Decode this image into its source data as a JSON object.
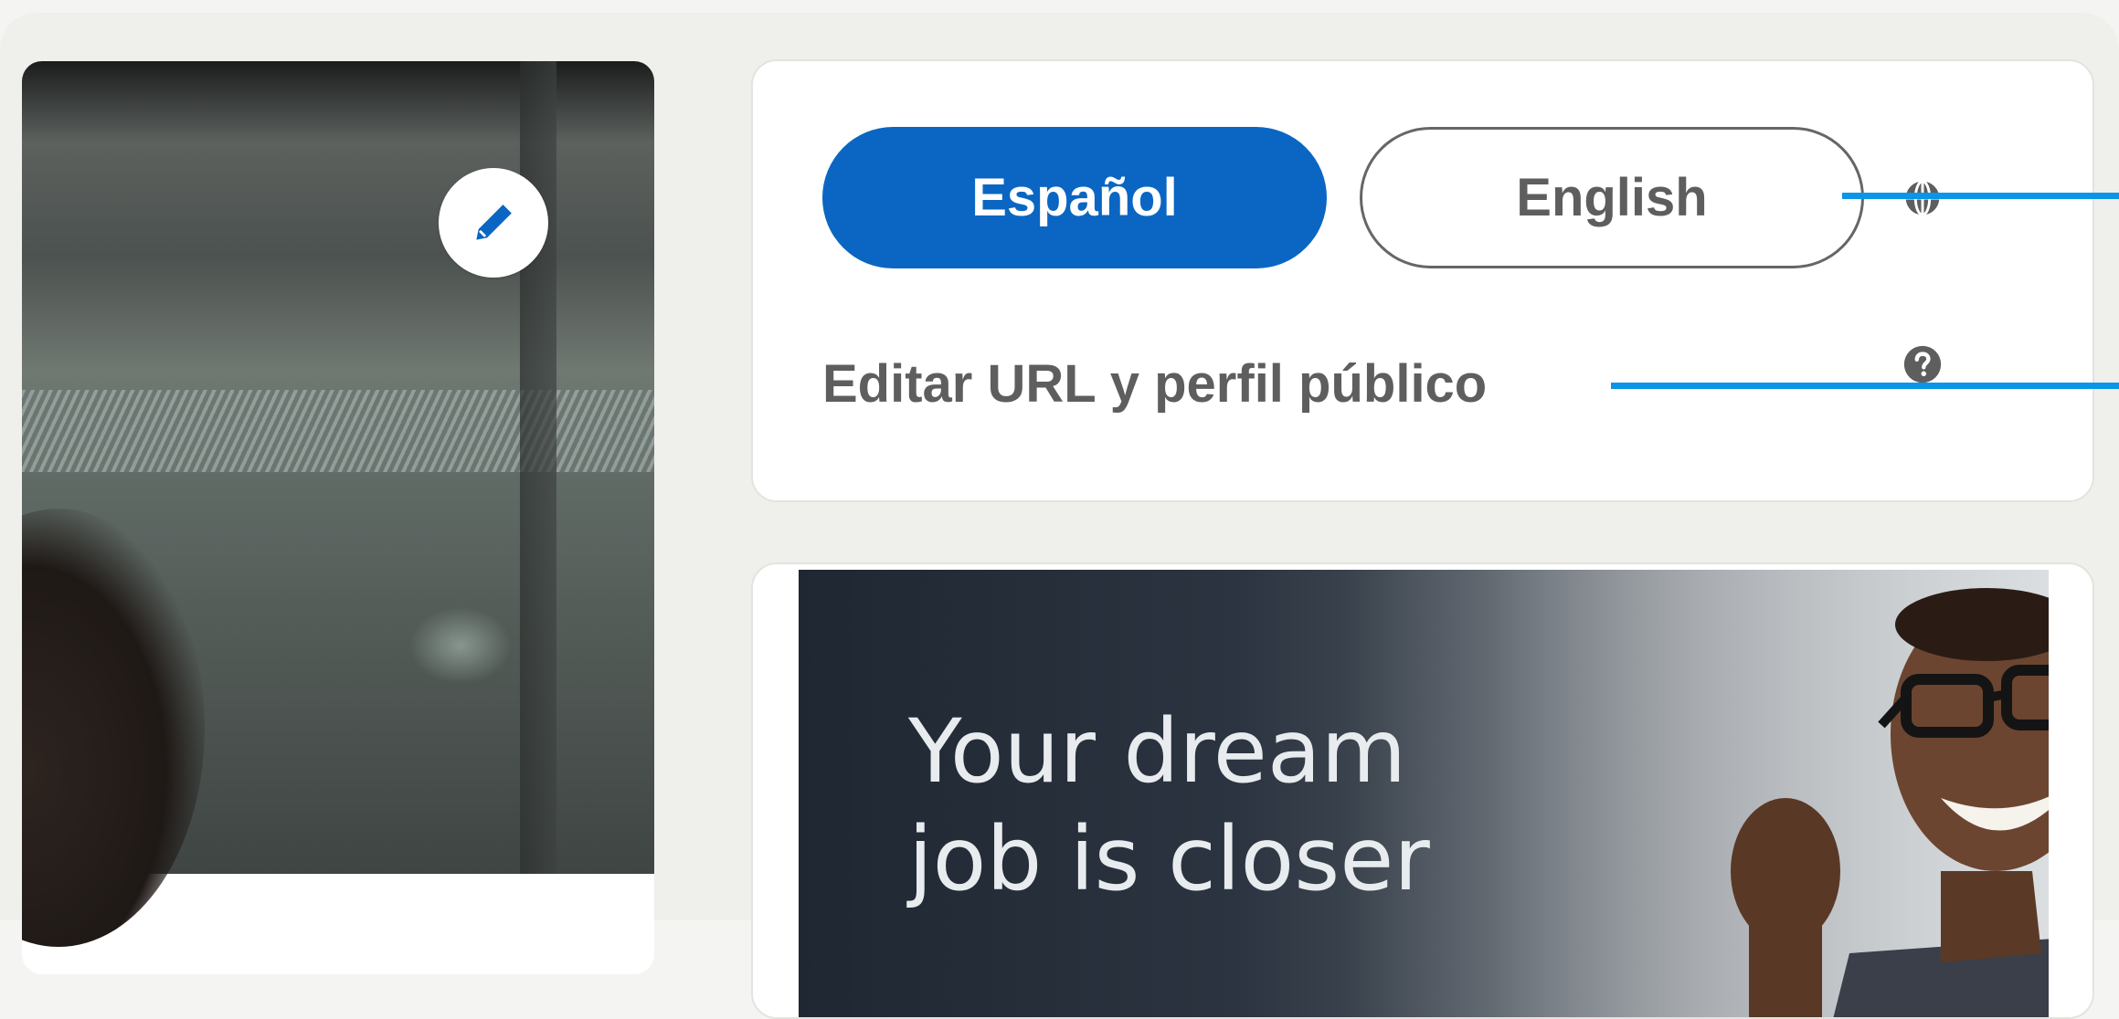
{
  "language_card": {
    "spanish_button": "Español",
    "english_button": "English",
    "profile_link": "Editar URL y perfil público",
    "globe_icon": "globe-icon",
    "help_icon": "question-mark-icon"
  },
  "profile_card": {
    "edit_icon": "pencil-icon"
  },
  "ad": {
    "headline_line1": "Your dream",
    "headline_line2": "job is closer"
  },
  "colors": {
    "accent": "#0a66c2",
    "callout": "#0a95e8",
    "text_gray": "#5e5e5e",
    "background": "#efefeb"
  }
}
